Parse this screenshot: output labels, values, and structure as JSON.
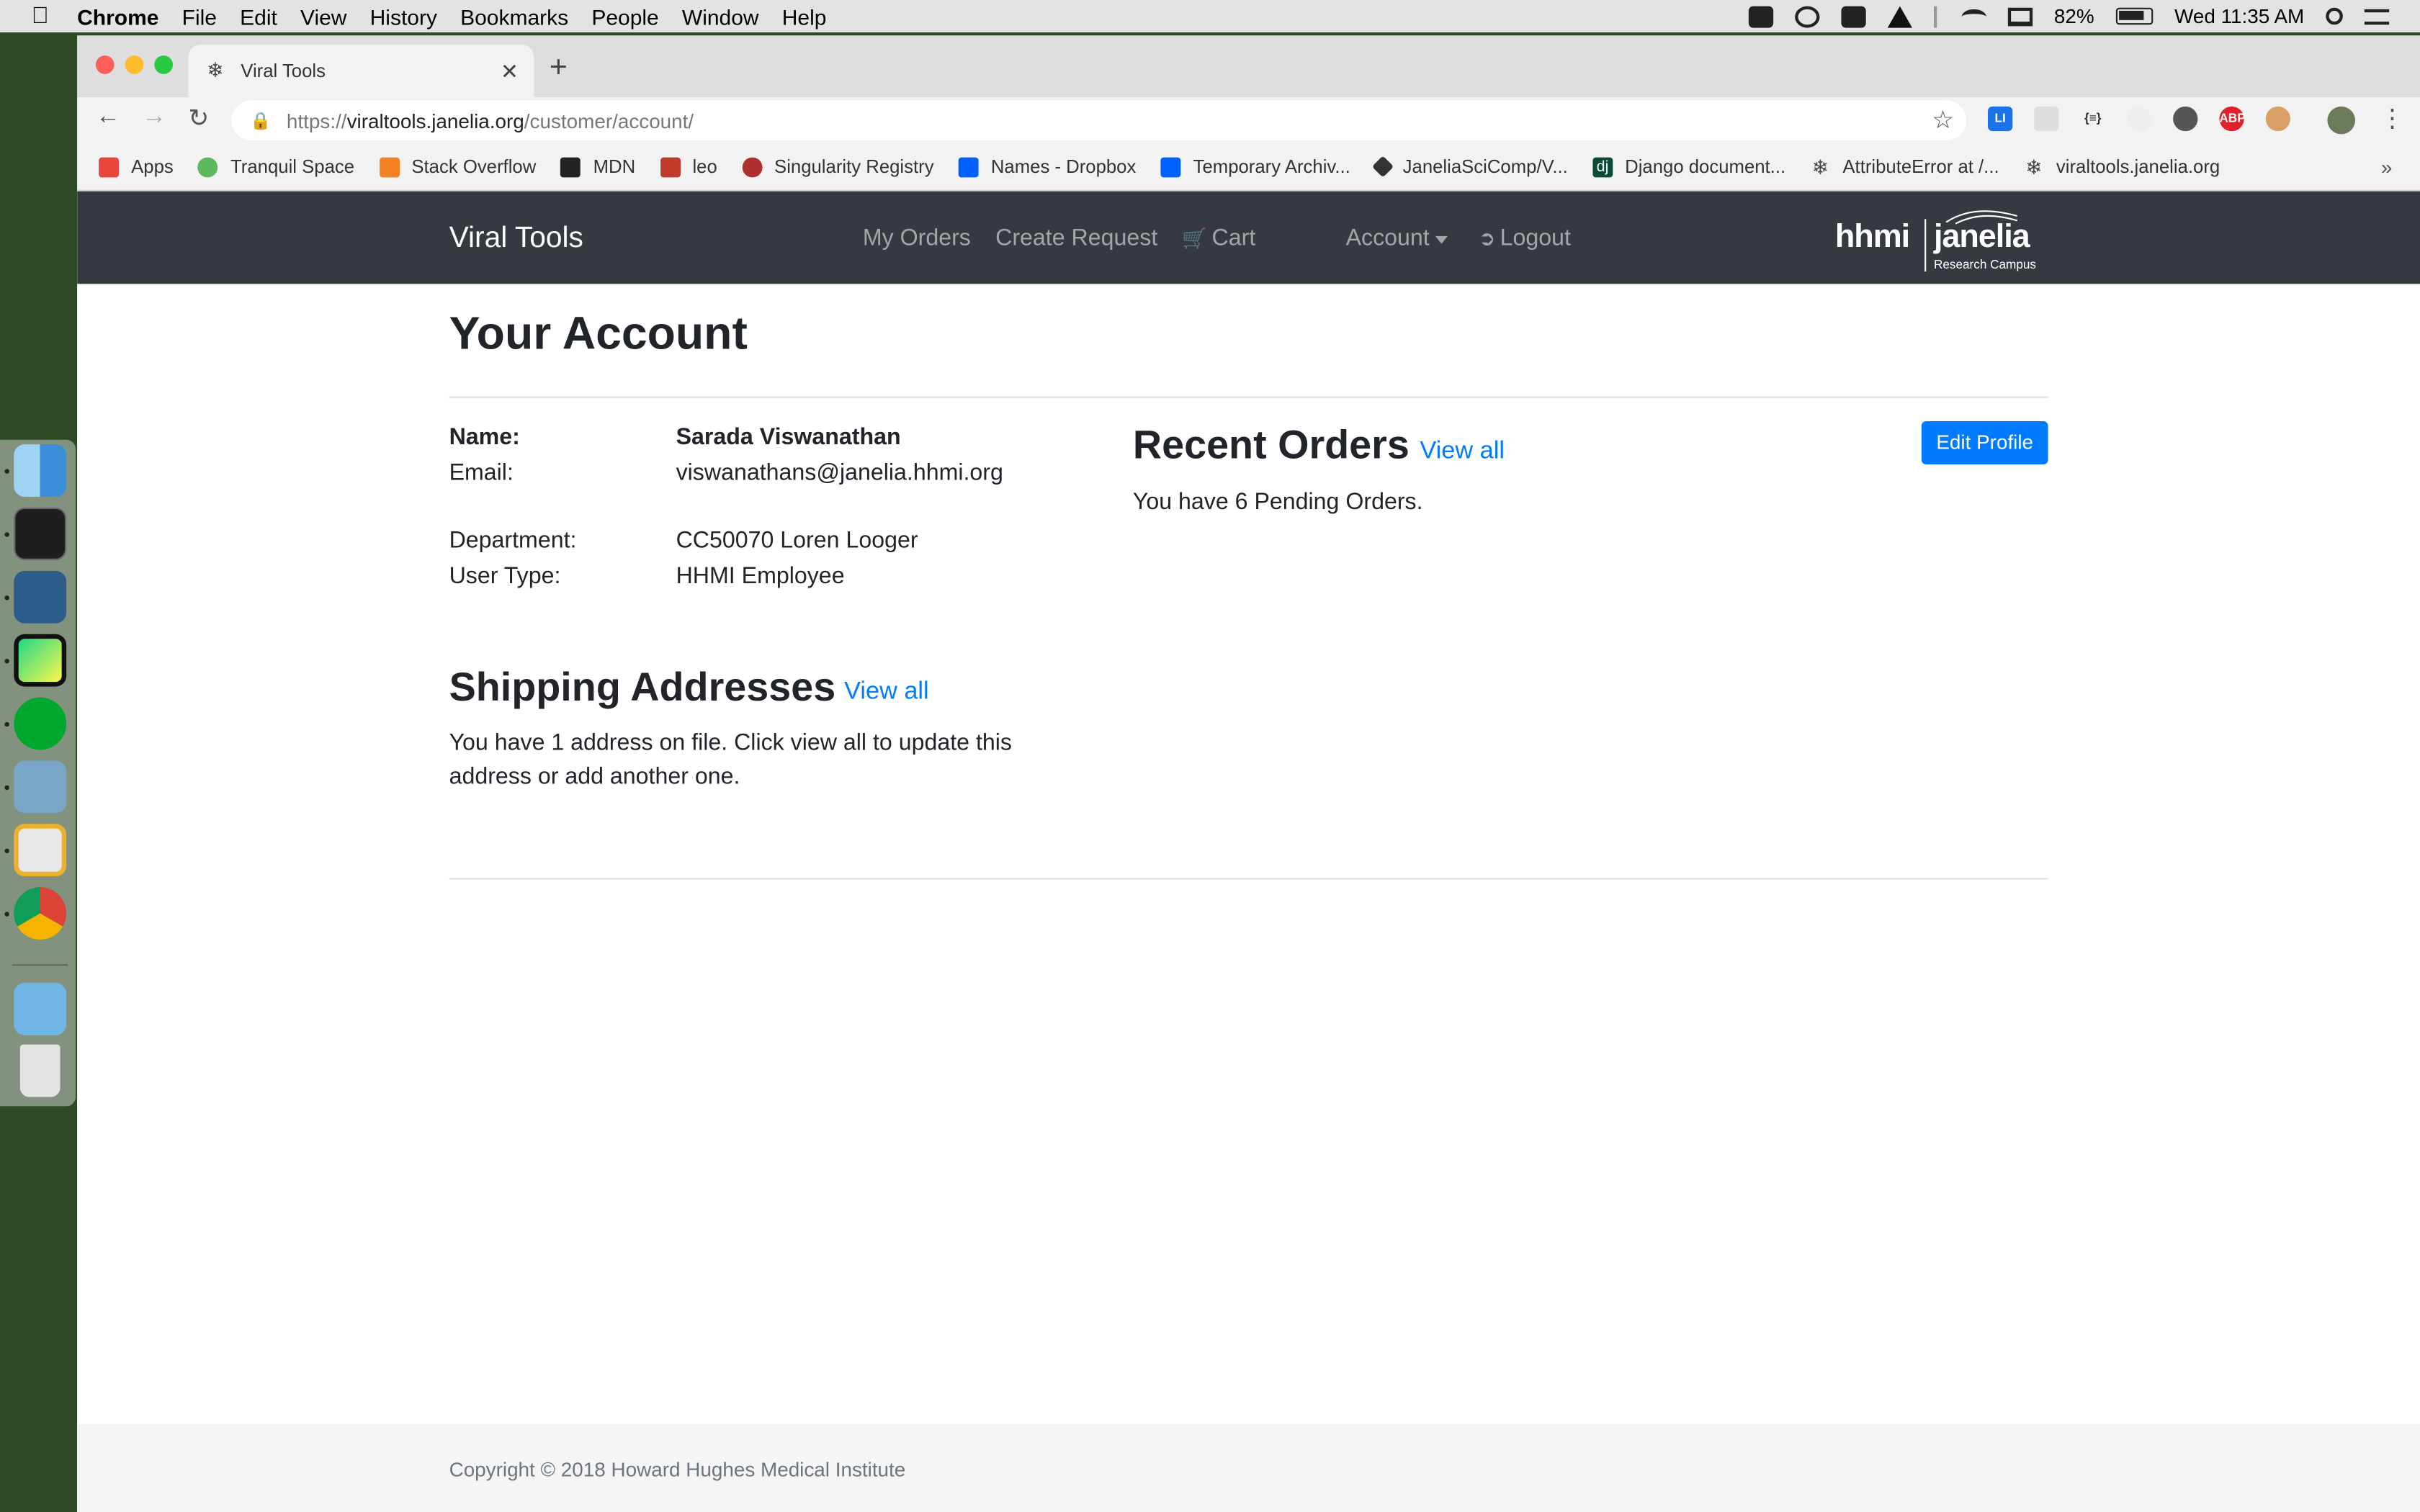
{
  "menubar": {
    "app": "Chrome",
    "items": [
      "File",
      "Edit",
      "View",
      "History",
      "Bookmarks",
      "People",
      "Window",
      "Help"
    ],
    "battery": "82%",
    "clock": "Wed 11:35 AM"
  },
  "browser": {
    "tab_title": "Viral Tools",
    "url_scheme": "https://",
    "url_host": "viraltools.janelia.org",
    "url_path": "/customer/account/",
    "bookmarks": [
      {
        "label": "Apps",
        "icon": "apps-grid-icon",
        "color": "#e8453c"
      },
      {
        "label": "Tranquil Space",
        "icon": "leaf-icon",
        "color": "#5cb85c"
      },
      {
        "label": "Stack Overflow",
        "icon": "stackoverflow-icon",
        "color": "#f48024"
      },
      {
        "label": "MDN",
        "icon": "mdn-icon",
        "color": "#222222"
      },
      {
        "label": "leo",
        "icon": "leo-icon",
        "color": "#c0392b"
      },
      {
        "label": "Singularity Registry",
        "icon": "singularity-icon",
        "color": "#b03030"
      },
      {
        "label": "Names - Dropbox",
        "icon": "dropbox-icon",
        "color": "#0061fe"
      },
      {
        "label": "Temporary Archiv...",
        "icon": "dropbox-icon",
        "color": "#0061fe"
      },
      {
        "label": "JaneliaSciComp/V...",
        "icon": "github-icon",
        "color": "#333333"
      },
      {
        "label": "Django document...",
        "icon": "django-icon",
        "color": "#0c4b33"
      },
      {
        "label": "AttributeError at /...",
        "icon": "snowflake-icon",
        "color": "#444444"
      },
      {
        "label": "viraltools.janelia.org",
        "icon": "snowflake-icon",
        "color": "#444444"
      }
    ],
    "bookmarks_more": "»"
  },
  "navbar": {
    "brand": "Viral Tools",
    "my_orders": "My Orders",
    "create_request": "Create Request",
    "cart": "Cart",
    "account": "Account",
    "logout": "Logout",
    "logo_left": "hhmi",
    "logo_right": "janelia",
    "logo_sub": "Research Campus"
  },
  "account": {
    "title": "Your Account",
    "name_label": "Name:",
    "name_value": "Sarada Viswanathan",
    "email_label": "Email:",
    "email_value": "viswanathans@janelia.hhmi.org",
    "department_label": "Department:",
    "department_value": "CC50070 Loren Looger",
    "user_type_label": "User Type:",
    "user_type_value": "HHMI Employee"
  },
  "recent_orders": {
    "heading": "Recent Orders",
    "view_all": "View all",
    "text": "You have 6 Pending Orders.",
    "edit_profile": "Edit Profile"
  },
  "shipping": {
    "heading": "Shipping Addresses",
    "view_all": "View all",
    "text": "You have 1 address on file. Click view all to update this address or add another one."
  },
  "footer": {
    "copyright": "Copyright © 2018 Howard Hughes Medical Institute"
  },
  "colors": {
    "navbar": "#343a40",
    "link": "#007bff",
    "button": "#007bff",
    "footer": "#f5f5f5"
  }
}
